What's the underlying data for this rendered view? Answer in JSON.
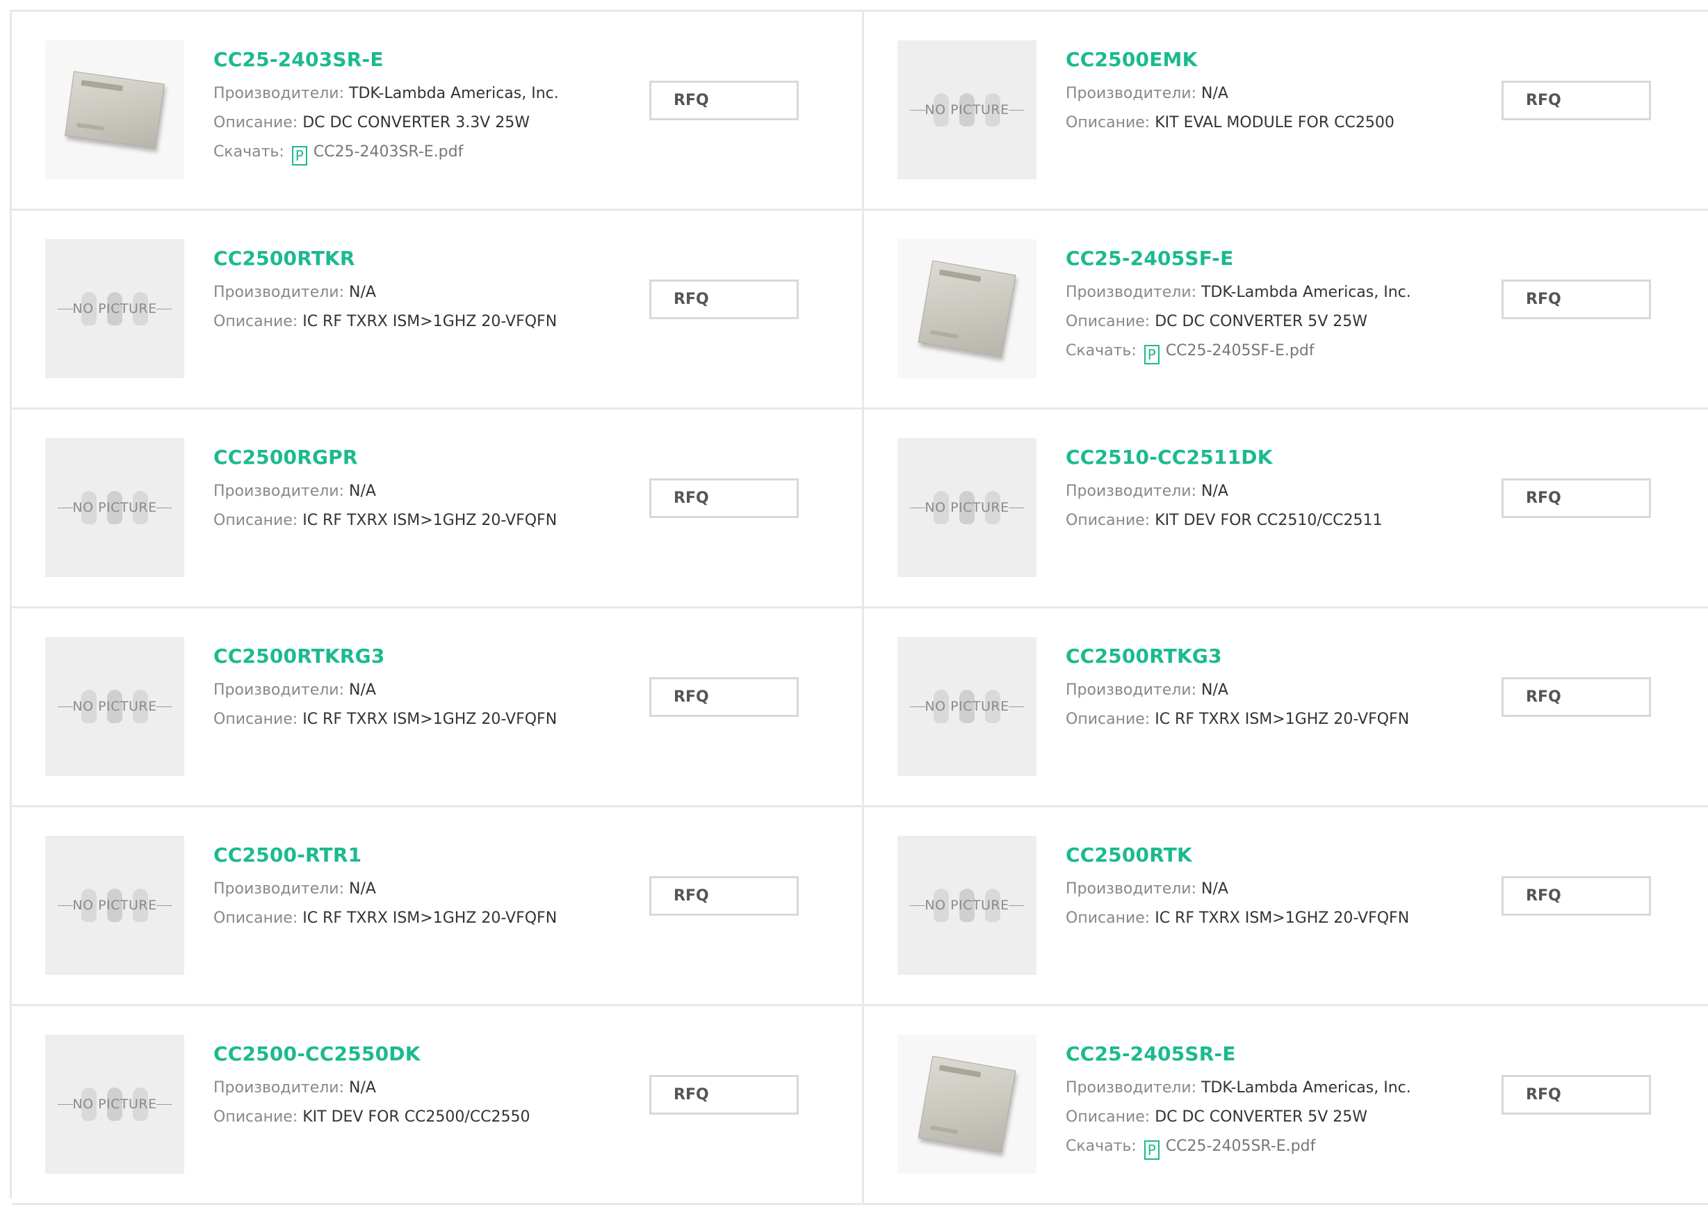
{
  "labels": {
    "manufacturer": "Производители:",
    "description": "Описание:",
    "download": "Скачать:",
    "rfq": "RFQ",
    "no_picture": "NO PICTURE",
    "pdf_glyph": "P"
  },
  "colors": {
    "title_accent": "#1bba8e",
    "label_gray": "#888888",
    "border": "#e8e8e8"
  },
  "products": [
    {
      "name": "CC25-2403SR-E",
      "manufacturer": "TDK-Lambda Americas, Inc.",
      "description": "DC DC CONVERTER 3.3V 25W",
      "download": "CC25-2403SR-E.pdf",
      "image": "module-photo"
    },
    {
      "name": "CC2500EMK",
      "manufacturer": "N/A",
      "description": "KIT EVAL MODULE FOR CC2500",
      "download": null,
      "image": "no-picture"
    },
    {
      "name": "CC2500RTKR",
      "manufacturer": "N/A",
      "description": "IC RF TXRX ISM>1GHZ 20-VFQFN",
      "download": null,
      "image": "no-picture"
    },
    {
      "name": "CC25-2405SF-E",
      "manufacturer": "TDK-Lambda Americas, Inc.",
      "description": "DC DC CONVERTER 5V 25W",
      "download": "CC25-2405SF-E.pdf",
      "image": "module-photo-square"
    },
    {
      "name": "CC2500RGPR",
      "manufacturer": "N/A",
      "description": "IC RF TXRX ISM>1GHZ 20-VFQFN",
      "download": null,
      "image": "no-picture"
    },
    {
      "name": "CC2510-CC2511DK",
      "manufacturer": "N/A",
      "description": "KIT DEV FOR CC2510/CC2511",
      "download": null,
      "image": "no-picture"
    },
    {
      "name": "CC2500RTKRG3",
      "manufacturer": "N/A",
      "description": "IC RF TXRX ISM>1GHZ 20-VFQFN",
      "download": null,
      "image": "no-picture"
    },
    {
      "name": "CC2500RTKG3",
      "manufacturer": "N/A",
      "description": "IC RF TXRX ISM>1GHZ 20-VFQFN",
      "download": null,
      "image": "no-picture"
    },
    {
      "name": "CC2500-RTR1",
      "manufacturer": "N/A",
      "description": "IC RF TXRX ISM>1GHZ 20-VFQFN",
      "download": null,
      "image": "no-picture"
    },
    {
      "name": "CC2500RTK",
      "manufacturer": "N/A",
      "description": "IC RF TXRX ISM>1GHZ 20-VFQFN",
      "download": null,
      "image": "no-picture"
    },
    {
      "name": "CC2500-CC2550DK",
      "manufacturer": "N/A",
      "description": "KIT DEV FOR CC2500/CC2550",
      "download": null,
      "image": "no-picture"
    },
    {
      "name": "CC25-2405SR-E",
      "manufacturer": "TDK-Lambda Americas, Inc.",
      "description": "DC DC CONVERTER 5V 25W",
      "download": "CC25-2405SR-E.pdf",
      "image": "module-photo-square"
    }
  ]
}
